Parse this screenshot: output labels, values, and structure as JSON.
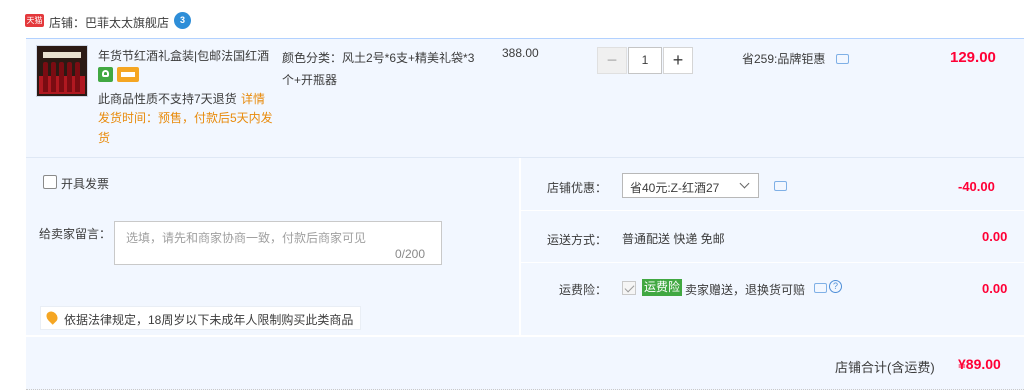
{
  "shop": {
    "badge": "天猫",
    "label": "店铺：巴菲太太旗舰店",
    "chat_badge": "3"
  },
  "item": {
    "title": "年货节红酒礼盒装|包邮法国红酒",
    "no_return": "此商品性质不支持7天退货",
    "detail_link": "详情",
    "ship_time": "发货时间：预售，付款后5天内发货",
    "sku": "颜色分类：风土2号*6支+精美礼袋*3个+开瓶器",
    "unit_price": "388.00",
    "quantity": "1",
    "qty_minus": "−",
    "qty_plus": "+",
    "promo": "省259:品牌钜惠",
    "total": "129.00"
  },
  "options": {
    "invoice_label": "开具发票",
    "message_label": "给卖家留言：",
    "message_placeholder": "选填，请先和商家协商一致，付款后商家可见",
    "message_count": "0/200",
    "legal_notice": "依据法律规定，18周岁以下未成年人限制购买此类商品",
    "coupon_label": "店铺优惠：",
    "coupon_value": "省40元:Z-红酒27",
    "coupon_amount": "-40.00",
    "shipping_label": "运送方式：",
    "shipping_value": "普通配送 快递 免邮",
    "shipping_amount": "0.00",
    "insurance_label": "运费险：",
    "insurance_tag": "运费险",
    "insurance_text": "卖家赠送，退换货可赔",
    "insurance_amount": "0.00"
  },
  "footer": {
    "label": "店铺合计(含运费)",
    "total": "¥89.00"
  },
  "colors": {
    "price_red": "#ff0036",
    "orange": "#e88b0c",
    "panel_bg": "#f2f7ff",
    "tmall_red": "#e4393c",
    "green": "#41a842"
  }
}
